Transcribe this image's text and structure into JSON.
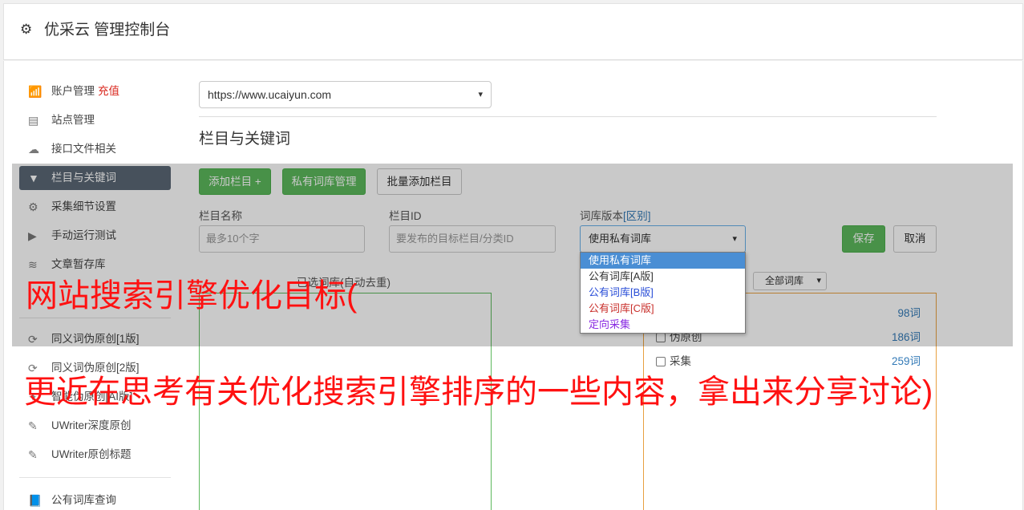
{
  "header": {
    "title": "优采云 管理控制台"
  },
  "sidebar": {
    "items": [
      {
        "label": "账户管理",
        "badge": "充值",
        "icon": "bar-chart-icon"
      },
      {
        "label": "站点管理",
        "icon": "server-icon"
      },
      {
        "label": "接口文件相关",
        "icon": "cloud-upload-icon"
      },
      {
        "label": "栏目与关键词",
        "icon": "filter-icon",
        "active": true
      },
      {
        "label": "采集细节设置",
        "icon": "gears-icon"
      },
      {
        "label": "手动运行测试",
        "icon": "play-circle-icon"
      },
      {
        "label": "文章暂存库",
        "icon": "database-icon"
      },
      {
        "label": "同义词伪原创[1版]",
        "icon": "refresh-icon"
      },
      {
        "label": "同义词伪原创[2版]",
        "icon": "refresh-icon"
      },
      {
        "label": "智能伪原创[AI版]",
        "icon": "brain-icon"
      },
      {
        "label": "UWriter深度原创",
        "icon": "edit-icon"
      },
      {
        "label": "UWriter原创标题",
        "icon": "edit-icon"
      },
      {
        "label": "公有词库查询",
        "icon": "book-icon"
      }
    ]
  },
  "main": {
    "site_select": "https://www.ucaiyun.com",
    "section_title": "栏目与关键词",
    "buttons": {
      "add_column": "添加栏目 +",
      "private_lib": "私有词库管理",
      "batch_add": "批量添加栏目",
      "save": "保存",
      "cancel": "取消"
    },
    "form": {
      "column_name_label": "栏目名称",
      "column_name_placeholder": "最多10个字",
      "column_id_label": "栏目ID",
      "column_id_placeholder": "要发布的目标栏目/分类ID",
      "version_label": "词库版本",
      "version_diff": "[区别]",
      "version_value": "使用私有词库"
    },
    "version_options": [
      {
        "label": "使用私有词库",
        "color": "#ffffff"
      },
      {
        "label": "公有词库[A版]",
        "color": "#333333"
      },
      {
        "label": "公有词库[B版]",
        "color": "#2b4fd8"
      },
      {
        "label": "公有词库[C版]",
        "color": "#c9302c"
      },
      {
        "label": "定向采集",
        "color": "#8a2be2"
      }
    ],
    "selected_list_title": "已选词库(自动去重)",
    "lib_filter": "全部词库",
    "libraries": [
      {
        "name": "",
        "count": "98词"
      },
      {
        "name": "伪原创",
        "count": "186词"
      },
      {
        "name": "采集",
        "count": "259词"
      }
    ]
  },
  "overlay_text": {
    "line1": "网站搜索引擎优化目标(",
    "line2": "更近在思考有关优化搜索引擎排序的一些内容，拿出来分享讨论)"
  }
}
